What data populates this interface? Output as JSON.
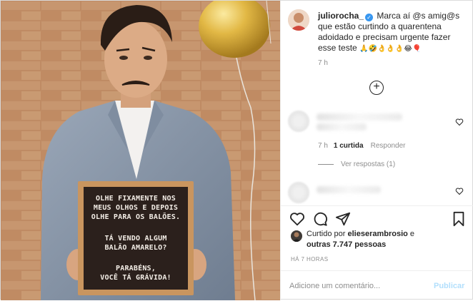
{
  "caption": {
    "username": "juliorocha_",
    "text": "Marca aí @s amig@s que estão curtindo a quarentena adoidado e precisam urgente fazer esse teste",
    "emojis": "🙏🤣👌👌👌😂🎈",
    "time": "7 h"
  },
  "sign": {
    "line1": "OLHE FIXAMENTE NOS\nMEUS OLHOS E DEPOIS\nOLHE PARA OS BALÕES.",
    "line2": "TÁ VENDO ALGUM\nBALÃO AMARELO?",
    "line3": "PARABÉNS,\nVOCÊ TÁ GRÁVIDA!"
  },
  "comment1": {
    "time": "7 h",
    "likes": "1 curtida",
    "reply": "Responder",
    "view_replies": "Ver respostas (1)"
  },
  "likes": {
    "prefix": "Curtido por",
    "user": "elieserambrosio",
    "and": "e",
    "others": "outras 7.747 pessoas"
  },
  "time_caps": "HÁ 7 HORAS",
  "add_comment": {
    "placeholder": "Adicione um comentário...",
    "publish": "Publicar"
  },
  "colors": {
    "verified": "#3897f0",
    "publish": "#b2dffc",
    "balloon": "#e2b845",
    "wall": "#b9855f",
    "suit": "#8c9aac"
  }
}
